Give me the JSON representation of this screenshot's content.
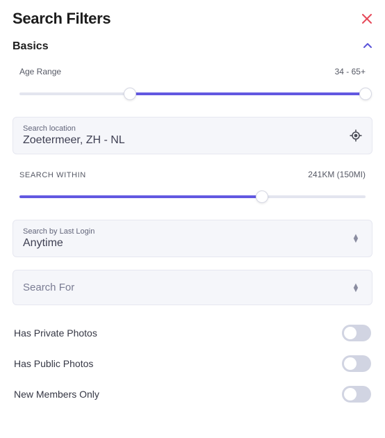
{
  "title": "Search Filters",
  "section": {
    "label": "Basics",
    "expanded": true
  },
  "age": {
    "label": "Age Range",
    "valueText": "34 - 65+",
    "startPct": 32,
    "endPct": 100
  },
  "location": {
    "label": "Search location",
    "value": "Zoetermeer, ZH - NL"
  },
  "distance": {
    "label": "SEARCH WITHIN",
    "valueText": "241KM (150MI)",
    "pct": 70
  },
  "lastLogin": {
    "label": "Search by Last Login",
    "value": "Anytime"
  },
  "searchFor": {
    "placeholder": "Search For"
  },
  "toggles": [
    {
      "label": "Has Private Photos",
      "on": false
    },
    {
      "label": "Has Public Photos",
      "on": false
    },
    {
      "label": "New Members Only",
      "on": false
    }
  ]
}
